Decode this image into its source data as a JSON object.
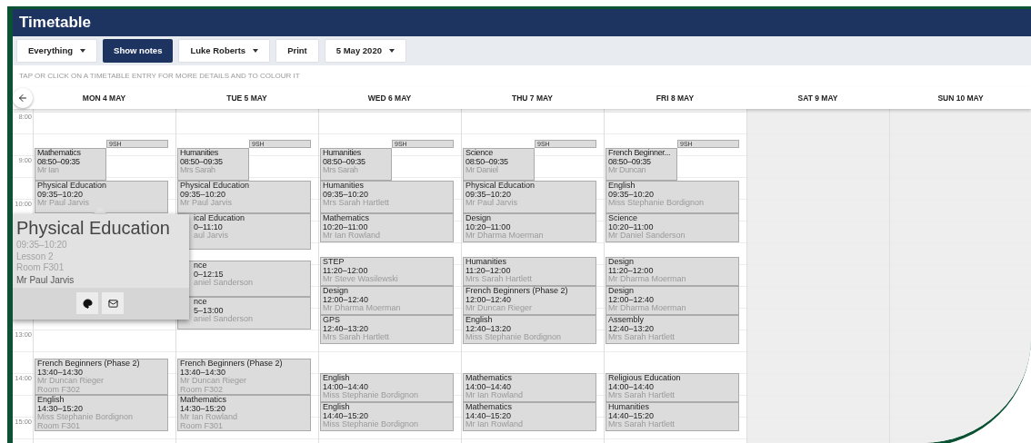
{
  "header": {
    "title": "Timetable"
  },
  "toolbar": [
    {
      "label": "Everything",
      "kind": "dropdown",
      "selected": false
    },
    {
      "label": "Show notes",
      "kind": "toggle",
      "selected": true
    },
    {
      "label": "Luke Roberts",
      "kind": "dropdown",
      "selected": false
    },
    {
      "label": "Print",
      "kind": "button",
      "selected": false
    },
    {
      "label": "5 May 2020",
      "kind": "dropdown",
      "selected": false
    }
  ],
  "hint": "TAP OR CLICK ON A TIMETABLE ENTRY FOR MORE DETAILS AND TO COLOUR IT",
  "time_labels": [
    {
      "label": "8:00"
    },
    {
      "label": "9:00"
    },
    {
      "label": "10:00"
    },
    {
      "label": "13:00"
    },
    {
      "label": "14:00"
    },
    {
      "label": "15:00"
    }
  ],
  "days": [
    {
      "label": "MON 4 MAY",
      "weekend": false,
      "registration": "9SH",
      "entries": [
        {
          "kind": "half",
          "covered": false,
          "subject": "Mathematics",
          "time": "08:50–09:35",
          "teacher": "Mr Ian"
        },
        {
          "kind": "full",
          "covered": false,
          "subject": "Physical Education",
          "time": "09:35–10:20",
          "teacher": "Mr Paul Jarvis"
        },
        {
          "kind": "full",
          "covered": false,
          "subject": "French Beginners (Phase 2)",
          "time": "13:40–14:30",
          "teacher": "Mr Duncan Rieger",
          "room": "Room F302"
        },
        {
          "kind": "full",
          "covered": false,
          "subject": "English",
          "time": "14:30–15:20",
          "teacher": "Miss Stephanie Bordignon",
          "room": "Room F301"
        }
      ]
    },
    {
      "label": "TUE 5 MAY",
      "weekend": false,
      "registration": "9SH",
      "entries": [
        {
          "kind": "half",
          "covered": false,
          "subject": "Humanities",
          "time": "08:50–09:35",
          "teacher": "Mrs Sarah"
        },
        {
          "kind": "full",
          "covered": false,
          "subject": "Physical Education",
          "time": "09:35–10:20",
          "teacher": "Mr Paul Jarvis"
        },
        {
          "kind": "full",
          "covered": true,
          "subject": "ical Education",
          "time": "0–11:10",
          "teacher": "aul Jarvis"
        },
        {
          "kind": "full",
          "covered": true,
          "subject": "nce",
          "time": "0–12:15",
          "teacher": "aniel Sanderson"
        },
        {
          "kind": "full",
          "covered": true,
          "subject": "nce",
          "time": "5–13:00",
          "teacher": "aniel Sanderson"
        },
        {
          "kind": "full",
          "covered": false,
          "subject": "French Beginners (Phase 2)",
          "time": "13:40–14:30",
          "teacher": "Mr Duncan Rieger",
          "room": "Room F302"
        },
        {
          "kind": "full",
          "covered": false,
          "subject": "Mathematics",
          "time": "14:30–15:20",
          "teacher": "Mr Ian Rowland",
          "room": "Room F301"
        }
      ]
    },
    {
      "label": "WED 6 MAY",
      "weekend": false,
      "registration": "9SH",
      "entries": [
        {
          "kind": "half",
          "covered": false,
          "subject": "Humanities",
          "time": "08:50–09:35",
          "teacher": "Mrs Sarah"
        },
        {
          "kind": "full",
          "covered": false,
          "subject": "Humanities",
          "time": "09:35–10:20",
          "teacher": "Mrs Sarah Hartlett"
        },
        {
          "kind": "full",
          "covered": false,
          "subject": "Mathematics",
          "time": "10:20–11:00",
          "teacher": "Mr Ian Rowland"
        },
        {
          "kind": "full",
          "covered": false,
          "subject": "STEP",
          "time": "11:20–12:00",
          "teacher": "Mr Steve Wasilewski"
        },
        {
          "kind": "full",
          "covered": false,
          "subject": "Design",
          "time": "12:00–12:40",
          "teacher": "Mr Dharma Moerman"
        },
        {
          "kind": "full",
          "covered": false,
          "subject": "GPS",
          "time": "12:40–13:20",
          "teacher": "Mrs Sarah Hartlett"
        },
        {
          "kind": "full",
          "covered": false,
          "subject": "English",
          "time": "14:00–14:40",
          "teacher": "Miss Stephanie Bordignon"
        },
        {
          "kind": "full",
          "covered": false,
          "subject": "English",
          "time": "14:40–15:20",
          "teacher": "Miss Stephanie Bordignon"
        }
      ]
    },
    {
      "label": "THU 7 MAY",
      "weekend": false,
      "registration": "9SH",
      "entries": [
        {
          "kind": "half",
          "covered": false,
          "subject": "Science",
          "time": "08:50–09:35",
          "teacher": "Mr Daniel"
        },
        {
          "kind": "full",
          "covered": false,
          "subject": "Physical Education",
          "time": "09:35–10:20",
          "teacher": "Mr Paul Jarvis"
        },
        {
          "kind": "full",
          "covered": false,
          "subject": "Design",
          "time": "10:20–11:00",
          "teacher": "Mr Dharma Moerman"
        },
        {
          "kind": "full",
          "covered": false,
          "subject": "Humanities",
          "time": "11:20–12:00",
          "teacher": "Mrs Sarah Hartlett"
        },
        {
          "kind": "full",
          "covered": false,
          "subject": "French Beginners (Phase 2)",
          "time": "12:00–12:40",
          "teacher": "Mr Duncan Rieger"
        },
        {
          "kind": "full",
          "covered": false,
          "subject": "English",
          "time": "12:40–13:20",
          "teacher": "Miss Stephanie Bordignon"
        },
        {
          "kind": "full",
          "covered": false,
          "subject": "Mathematics",
          "time": "14:00–14:40",
          "teacher": "Mr Ian Rowland"
        },
        {
          "kind": "full",
          "covered": false,
          "subject": "Mathematics",
          "time": "14:40–15:20",
          "teacher": "Mr Ian Rowland"
        }
      ]
    },
    {
      "label": "FRI 8 MAY",
      "weekend": false,
      "registration": "9SH",
      "entries": [
        {
          "kind": "half",
          "covered": false,
          "subject": "French Beginner...",
          "time": "08:50–09:35",
          "teacher": "Mr Duncan"
        },
        {
          "kind": "full",
          "covered": false,
          "subject": "English",
          "time": "09:35–10:20",
          "teacher": "Miss Stephanie Bordignon"
        },
        {
          "kind": "full",
          "covered": false,
          "subject": "Science",
          "time": "10:20–11:00",
          "teacher": "Mr Daniel Sanderson"
        },
        {
          "kind": "full",
          "covered": false,
          "subject": "Design",
          "time": "11:20–12:00",
          "teacher": "Mr Dharma Moerman"
        },
        {
          "kind": "full",
          "covered": false,
          "subject": "Design",
          "time": "12:00–12:40",
          "teacher": "Mr Dharma Moerman"
        },
        {
          "kind": "full",
          "covered": false,
          "subject": "Assembly",
          "time": "12:40–13:20",
          "teacher": "Mrs Sarah Hartlett"
        },
        {
          "kind": "full",
          "covered": false,
          "subject": "Religious Education",
          "time": "14:00–14:40",
          "teacher": "Mrs Sarah Hartlett"
        },
        {
          "kind": "full",
          "covered": false,
          "subject": "Humanities",
          "time": "14:40–15:20",
          "teacher": "Mrs Sarah Hartlett"
        }
      ]
    },
    {
      "label": "SAT 9 MAY",
      "weekend": true
    },
    {
      "label": "SUN 10 MAY",
      "weekend": true
    }
  ],
  "popup": {
    "title": "Physical Education",
    "details": [
      "09:35–10:20",
      "Lesson 2",
      "Room F301"
    ],
    "teacher": "Mr Paul Jarvis",
    "actions": [
      {
        "kind": "palette"
      },
      {
        "kind": "message"
      }
    ]
  }
}
